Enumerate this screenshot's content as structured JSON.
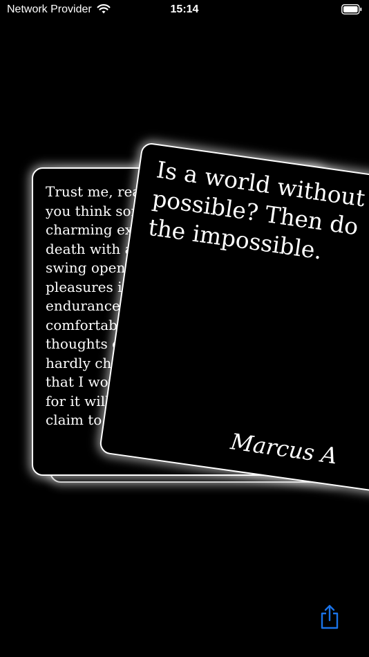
{
  "status_bar": {
    "carrier": "Network Provider",
    "time": "15:14"
  },
  "back_card": {
    "lines": [
      "Trust me, real joy",
      "you think someone",
      "charming expressi",
      "death with an e",
      "swing open the",
      "pleasures in ch",
      "endurance of s",
      "comfortable w",
      "thoughts over",
      "hardly cheer",
      "that I would",
      "for it will ne",
      "claim to its"
    ]
  },
  "front_card": {
    "lines": [
      "Is a world without",
      "possible? Then do",
      "the impossible."
    ],
    "author": "Marcus A"
  },
  "icons": {
    "wifi": "wifi-icon",
    "battery": "battery-icon",
    "share": "share-icon"
  },
  "colors": {
    "background": "#000000",
    "card_border": "#ffffff",
    "accent": "#1a73e8"
  }
}
